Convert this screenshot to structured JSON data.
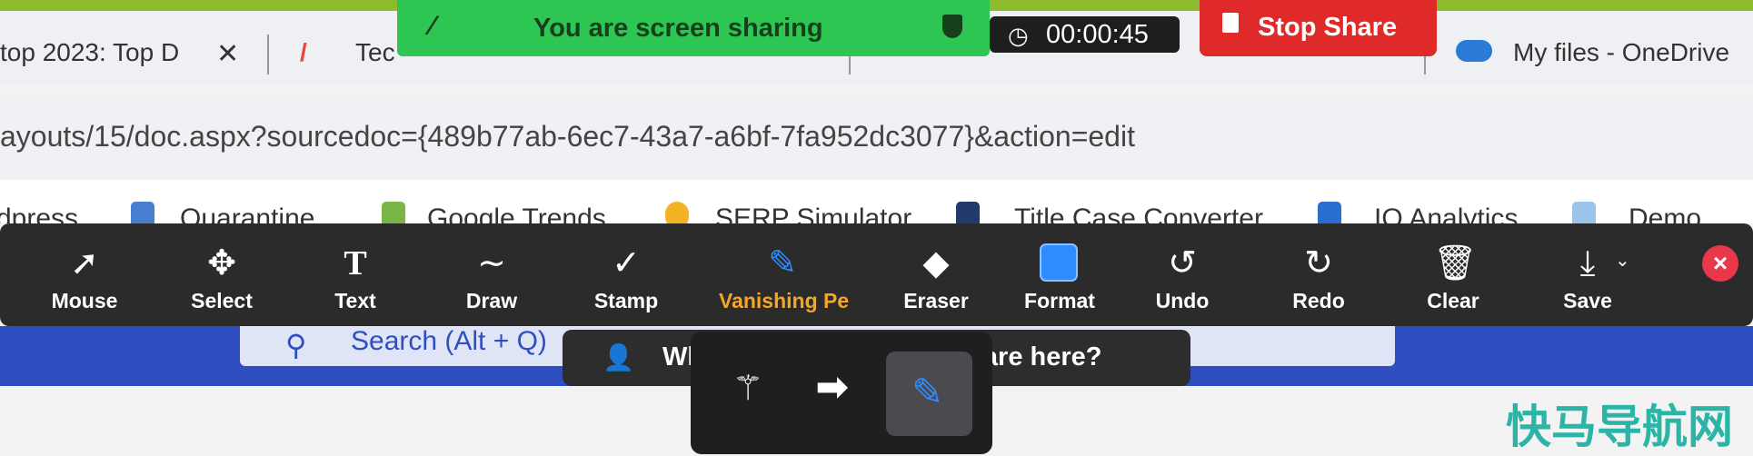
{
  "browser": {
    "tabs": [
      {
        "title": "top 2023: Top D",
        "close": "✕"
      },
      {
        "title": "Tec"
      },
      {
        "title": "My files - OneDrive"
      }
    ],
    "address": "ayouts/15/doc.aspx?sourcedoc={489b77ab-6ec7-43a7-a6bf-7fa952dc3077}&action=edit",
    "bookmarks": [
      "dpress",
      "Quarantine",
      "Google Trends",
      "SERP Simulator",
      "Title Case Converter",
      "IQ Analytics",
      "Demo"
    ]
  },
  "share_banner": {
    "status": "You are screen sharing",
    "timer": "00:00:45",
    "stop_label": "Stop Share",
    "colors": {
      "green": "#2dc653",
      "red": "#e02a2a"
    }
  },
  "annotation_toolbar": {
    "tools": [
      {
        "label": "Mouse",
        "icon": "cursor-arrow-icon"
      },
      {
        "label": "Select",
        "icon": "move-arrows-icon"
      },
      {
        "label": "Text",
        "icon": "text-T-icon"
      },
      {
        "label": "Draw",
        "icon": "squiggle-icon"
      },
      {
        "label": "Stamp",
        "icon": "checkmark-icon"
      },
      {
        "label": "Vanishing Pe",
        "icon": "vanishing-pen-icon",
        "active": true
      },
      {
        "label": "Eraser",
        "icon": "eraser-icon"
      },
      {
        "label": "Format",
        "icon": "color-square-icon"
      },
      {
        "label": "Undo",
        "icon": "undo-icon"
      },
      {
        "label": "Redo",
        "icon": "redo-icon"
      },
      {
        "label": "Clear",
        "icon": "trash-icon"
      },
      {
        "label": "Save",
        "icon": "save-download-icon"
      }
    ],
    "active_color": "#f6a623"
  },
  "page": {
    "search_placeholder": "Search (Alt + Q)"
  },
  "who_can_see": "Who can see what you share here?",
  "watermark": "快马导航网"
}
